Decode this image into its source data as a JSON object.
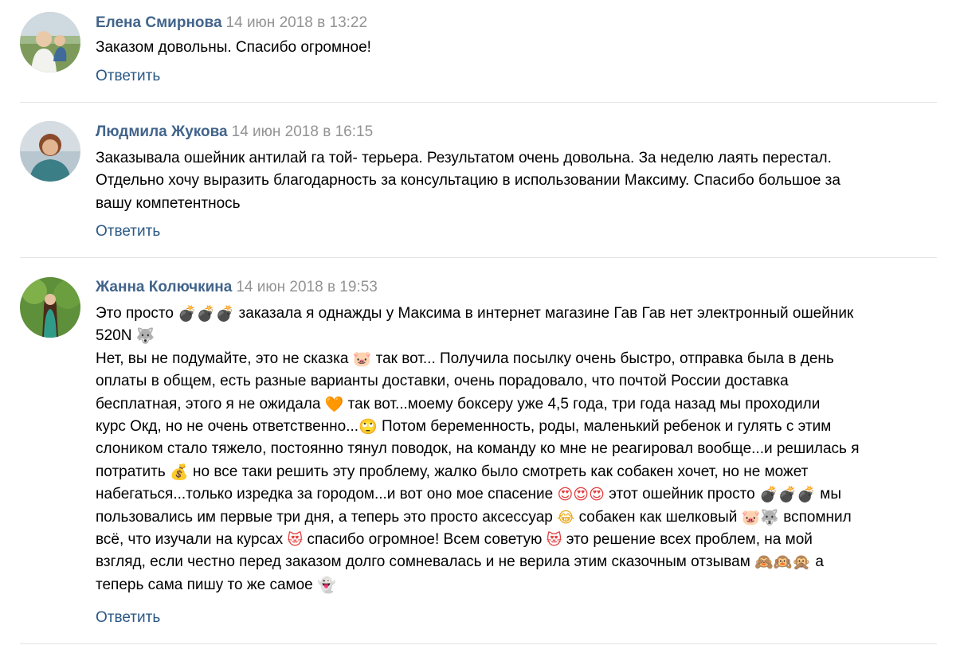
{
  "comments": [
    {
      "author": "Елена Смирнова",
      "date": "14 июн 2018 в 13:22",
      "text": "Заказом довольны. Спасибо огромное!",
      "reply": "Ответить"
    },
    {
      "author": "Людмила Жукова",
      "date": "14 июн 2018 в 16:15",
      "lines": [
        "Заказывала ошейник антилай га той- терьера. Результатом очень довольна. За неделю лаять перестал.",
        "Отдельно хочу выразить благодарность за консультацию в использовании Максиму. Спасибо большое за",
        "вашу компетентнось"
      ],
      "reply": "Ответить"
    },
    {
      "author": "Жанна Колючкина",
      "date": "14 июн 2018 в 19:53",
      "segments": {
        "s1": "Это просто ",
        "s2": " заказала я однажды у Максима в интернет магазине Гав Гав нет электронный ошейник",
        "s3": "520N ",
        "s4": "Нет, вы не подумайте, это не сказка ",
        "s5": " так вот... Получила посылку очень быстро, отправка была в день",
        "s6": "оплаты в общем, есть разные варианты доставки, очень порадовало, что почтой России доставка",
        "s7": "бесплатная, этого я не ожидала ",
        "s8": " так вот...моему боксеру уже 4,5 года, три года назад мы проходили",
        "s9": "курс Окд, но не очень ответственно...",
        "s10": " Потом беременность, роды, маленький ребенок и гулять с этим",
        "s11": "слоником стало тяжело, постоянно тянул поводок, на команду ко мне не реагировал вообще...и решилась я",
        "s12": "потратить ",
        "s13": " но все таки решить эту проблему, жалко было смотреть как собакен хочет, но не может",
        "s14": "набегаться...только изредка за городом...и вот оно мое спасение ",
        "s15": " этот ошейник просто ",
        "s16": " мы",
        "s17": "пользовались им первые три дня, а теперь это просто аксессуар ",
        "s18": " собакен как шелковый ",
        "s19": " вспомнил",
        "s20": "всё, что изучали на курсах ",
        "s21": " спасибо огромное! Всем советую ",
        "s22": " это решение всех проблем, на мой",
        "s23": "взгляд, если честно перед заказом долго сомневалась и не верила этим сказочным отзывам ",
        "s24": " а",
        "s25": "теперь сама пишу то же самое "
      },
      "emoji": {
        "bomb": "💣",
        "wolf": "🐺",
        "pig": "🐷",
        "heart": "🧡",
        "rolling_eyes": "🙄",
        "money_bag": "💰",
        "heart_eyes": "😍",
        "joy": "😂",
        "heart_eyes_cat": "😻",
        "monkeys": "🙈🙉🙊",
        "ghost": "👻"
      },
      "reply": "Ответить"
    }
  ],
  "colors": {
    "author": "#42648b",
    "date": "#939393",
    "reply": "#2a5885",
    "separator": "#e3e4e8"
  }
}
